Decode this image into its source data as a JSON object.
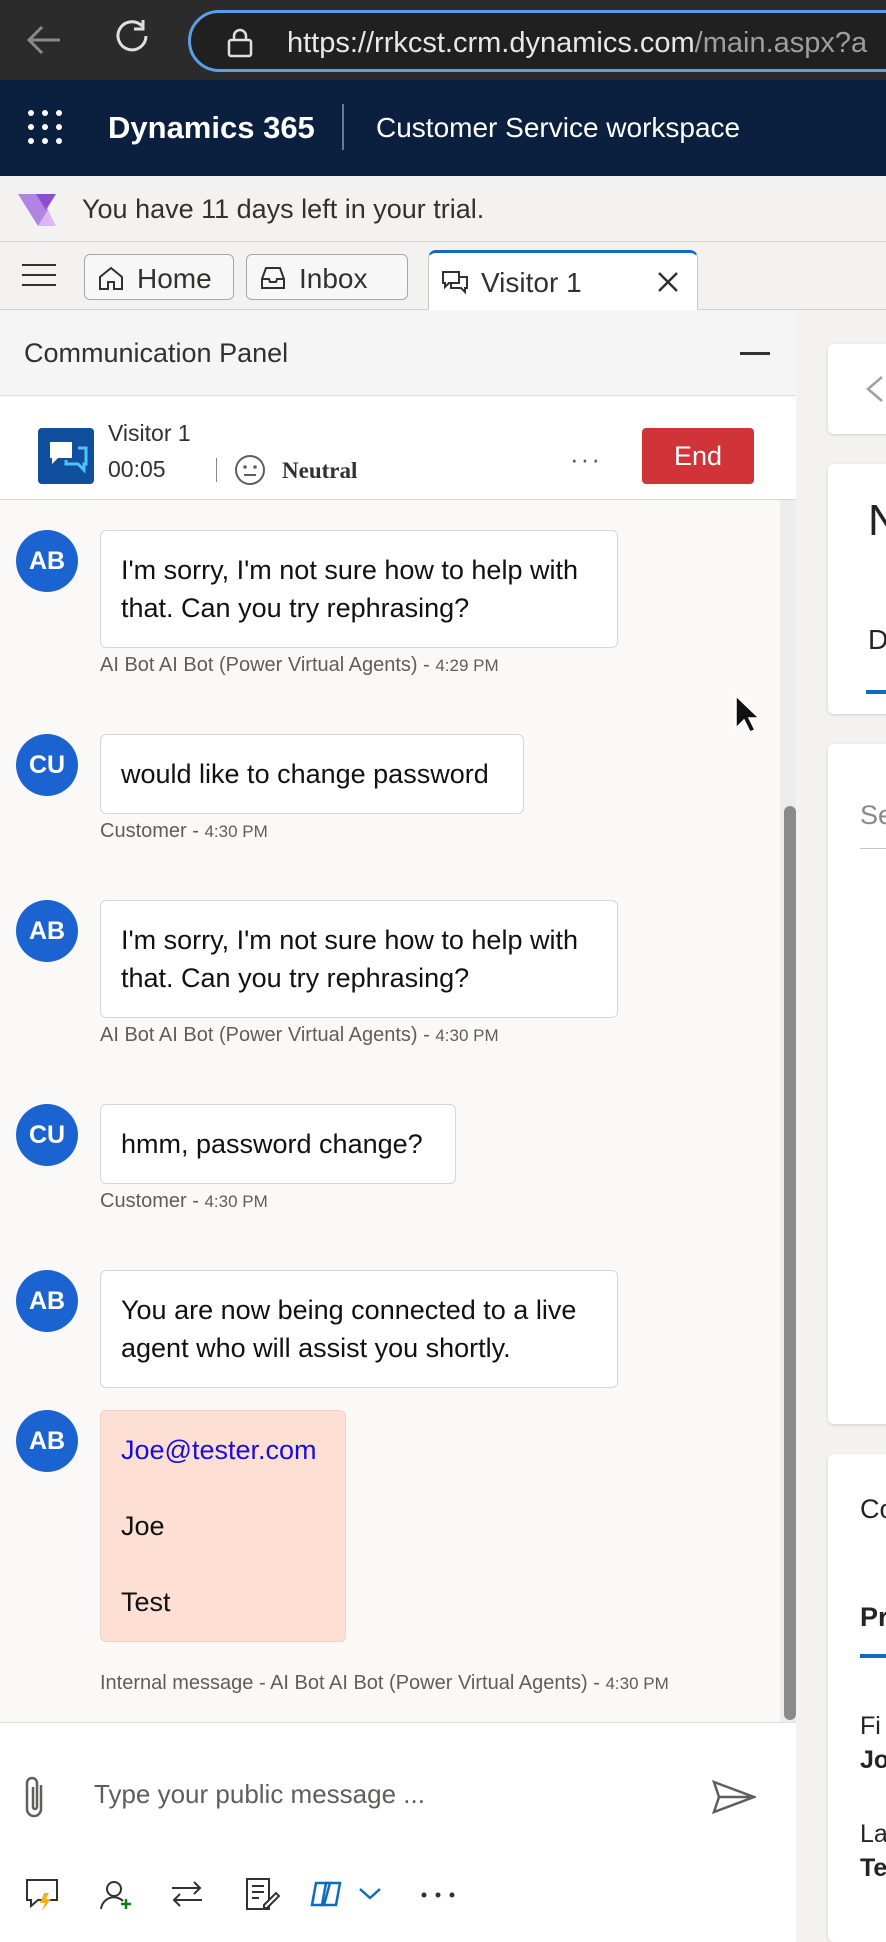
{
  "browser": {
    "url_domain": "https://rrkcst.crm.dynamics.com",
    "url_path": "/main.aspx?a"
  },
  "app": {
    "title": "Dynamics 365",
    "subtitle": "Customer Service workspace"
  },
  "trial_banner": {
    "text": "You have 11 days left in your trial."
  },
  "tabs": [
    {
      "label": "Home",
      "icon": "home-icon"
    },
    {
      "label": "Inbox",
      "icon": "inbox-icon"
    },
    {
      "label": "Visitor 1",
      "icon": "chat-icon",
      "active": true
    }
  ],
  "panel": {
    "title": "Communication Panel",
    "conversation": {
      "name": "Visitor 1",
      "timer": "00:05",
      "sentiment": "Neutral",
      "more": "···",
      "end_label": "End"
    },
    "messages": [
      {
        "avatar": "AB",
        "lines": [
          "I'm sorry, I'm not sure how to help with",
          "that. Can you try rephrasing?"
        ],
        "sender": "AI Bot AI Bot (Power Virtual Agents) - ",
        "time": "4:29 PM"
      },
      {
        "avatar": "CU",
        "lines": [
          "would like to change password"
        ],
        "sender": "Customer - ",
        "time": "4:30 PM"
      },
      {
        "avatar": "AB",
        "lines": [
          "I'm sorry, I'm not sure how to help with",
          "that. Can you try rephrasing?"
        ],
        "sender": "AI Bot AI Bot (Power Virtual Agents) - ",
        "time": "4:30 PM"
      },
      {
        "avatar": "CU",
        "lines": [
          "hmm, password change?"
        ],
        "sender": "Customer - ",
        "time": "4:30 PM"
      },
      {
        "avatar": "AB",
        "lines": [
          "You are now being connected to a live",
          "agent who will assist you shortly."
        ],
        "sender": "",
        "time": ""
      },
      {
        "avatar": "AB",
        "internal": true,
        "email": "Joe@tester.com",
        "first": "Joe",
        "last": "Test",
        "sender": "Internal message - AI Bot AI Bot (Power Virtual Agents) - ",
        "time": "4:30 PM"
      }
    ],
    "composer": {
      "placeholder": "Type your public message ..."
    }
  },
  "right_pane": {
    "letters": [
      "N",
      "D",
      "Se",
      "Co",
      "Pr",
      "Fi",
      "Jo",
      "La",
      "Te"
    ]
  },
  "colors": {
    "accent": "#0f6cbd",
    "header": "#0b1f3f",
    "end": "#d13438",
    "avatar": "#1b63d1",
    "internal": "#fde0d3"
  }
}
